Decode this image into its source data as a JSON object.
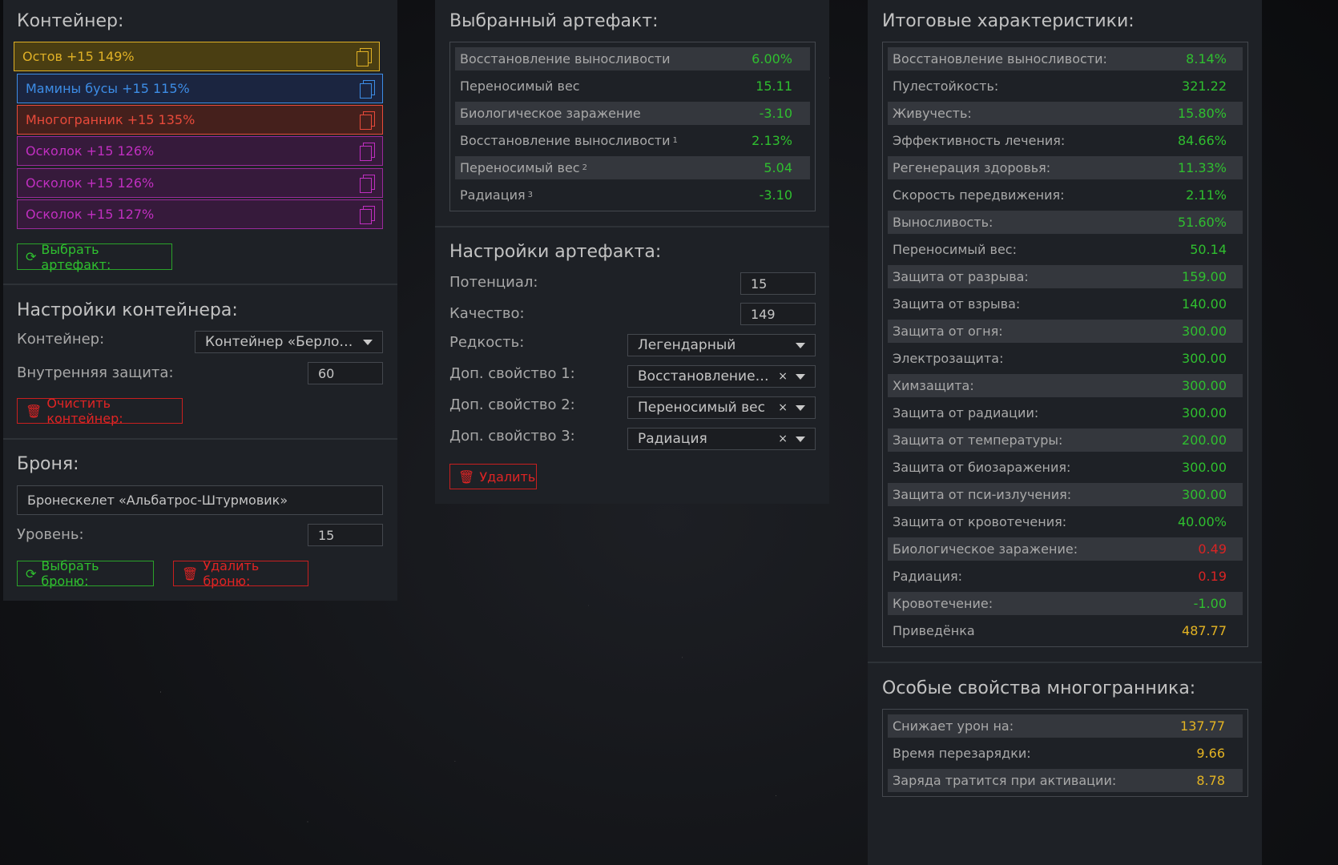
{
  "left": {
    "container_title": "Контейнер:",
    "artifacts": [
      {
        "label": "Остов +15 149%",
        "color": "#e0b126",
        "bg": "#4a3e12",
        "border": "#e0b126"
      },
      {
        "label": "Мамины бусы +15 115%",
        "color": "#3d8de6",
        "bg": "#1b2540",
        "border": "#3d8de6"
      },
      {
        "label": "Многогранник +15 135%",
        "color": "#e84a3a",
        "bg": "#45201c",
        "border": "#e84a3a"
      },
      {
        "label": "Осколок +15 126%",
        "color": "#c02fc0",
        "bg": "#361a3b",
        "border": "#9b2a9b"
      },
      {
        "label": "Осколок +15 126%",
        "color": "#c02fc0",
        "bg": "#361a3b",
        "border": "#9b2a9b"
      },
      {
        "label": "Осколок +15 127%",
        "color": "#c02fc0",
        "bg": "#361a3b",
        "border": "#9b2a9b"
      }
    ],
    "choose_artifact": "Выбрать артефакт:",
    "settings_title": "Настройки контейнера:",
    "container_label": "Контейнер:",
    "container_value": "Контейнер «Берлога...",
    "inner_protection_label": "Внутренняя защита:",
    "inner_protection_value": "60",
    "clear_container": "Очистить контейнер:",
    "armor_title": "Броня:",
    "armor_value": "Бронескелет «Альбатрос-Штурмовик»",
    "level_label": "Уровень:",
    "level_value": "15",
    "choose_armor": "Выбрать броню:",
    "delete_armor": "Удалить броню:"
  },
  "middle": {
    "selected_title": "Выбранный артефакт:",
    "stats": [
      {
        "name": "Восстановление выносливости",
        "sup": "",
        "value": "6.00%"
      },
      {
        "name": "Переносимый вес",
        "sup": "",
        "value": "15.11"
      },
      {
        "name": "Биологическое заражение",
        "sup": "",
        "value": "-3.10"
      },
      {
        "name": "Восстановление выносливости",
        "sup": "1",
        "value": "2.13%"
      },
      {
        "name": "Переносимый вес",
        "sup": "2",
        "value": "5.04"
      },
      {
        "name": "Радиация",
        "sup": "3",
        "value": "-3.10"
      }
    ],
    "settings_title": "Настройки артефакта:",
    "potential_label": "Потенциал:",
    "potential_value": "15",
    "quality_label": "Качество:",
    "quality_value": "149",
    "rarity_label": "Редкость:",
    "rarity_value": "Легендарный",
    "prop1_label": "Доп. свойство 1:",
    "prop1_value": "Восстановление в...",
    "prop2_label": "Доп. свойство 2:",
    "prop2_value": "Переносимый вес",
    "prop3_label": "Доп. свойство 3:",
    "prop3_value": "Радиация",
    "clear_glyph": "×",
    "delete": "Удалить"
  },
  "right": {
    "totals_title": "Итоговые характеристики:",
    "totals": [
      {
        "name": "Восстановление выносливости:",
        "value": "8.14%",
        "tone": "g"
      },
      {
        "name": "Пулестойкость:",
        "value": "321.22",
        "tone": "g"
      },
      {
        "name": "Живучесть:",
        "value": "15.80%",
        "tone": "g"
      },
      {
        "name": "Эффективность лечения:",
        "value": "84.66%",
        "tone": "g"
      },
      {
        "name": "Регенерация здоровья:",
        "value": "11.33%",
        "tone": "g"
      },
      {
        "name": "Скорость передвижения:",
        "value": "2.11%",
        "tone": "g"
      },
      {
        "name": "Выносливость:",
        "value": "51.60%",
        "tone": "g"
      },
      {
        "name": "Переносимый вес:",
        "value": "50.14",
        "tone": "g"
      },
      {
        "name": "Защита от разрыва:",
        "value": "159.00",
        "tone": "g"
      },
      {
        "name": "Защита от взрыва:",
        "value": "140.00",
        "tone": "g"
      },
      {
        "name": "Защита от огня:",
        "value": "300.00",
        "tone": "g"
      },
      {
        "name": "Электрозащита:",
        "value": "300.00",
        "tone": "g"
      },
      {
        "name": "Химзащита:",
        "value": "300.00",
        "tone": "g"
      },
      {
        "name": "Защита от радиации:",
        "value": "300.00",
        "tone": "g"
      },
      {
        "name": "Защита от температуры:",
        "value": "200.00",
        "tone": "g"
      },
      {
        "name": "Защита от биозаражения:",
        "value": "300.00",
        "tone": "g"
      },
      {
        "name": "Защита от пси-излучения:",
        "value": "300.00",
        "tone": "g"
      },
      {
        "name": "Защита от кровотечения:",
        "value": "40.00%",
        "tone": "g"
      },
      {
        "name": "Биологическое заражение:",
        "value": "0.49",
        "tone": "r"
      },
      {
        "name": "Радиация:",
        "value": "0.19",
        "tone": "r"
      },
      {
        "name": "Кровотечение:",
        "value": "-1.00",
        "tone": "g"
      },
      {
        "name": "Приведёнка",
        "value": "487.77",
        "tone": "y"
      }
    ],
    "special_title": "Особые свойства многогранника:",
    "special": [
      {
        "name": "Снижает урон на:",
        "value": "137.77"
      },
      {
        "name": "Время перезарядки:",
        "value": "9.66"
      },
      {
        "name": "Заряда тратится при активации:",
        "value": "8.78"
      }
    ]
  }
}
